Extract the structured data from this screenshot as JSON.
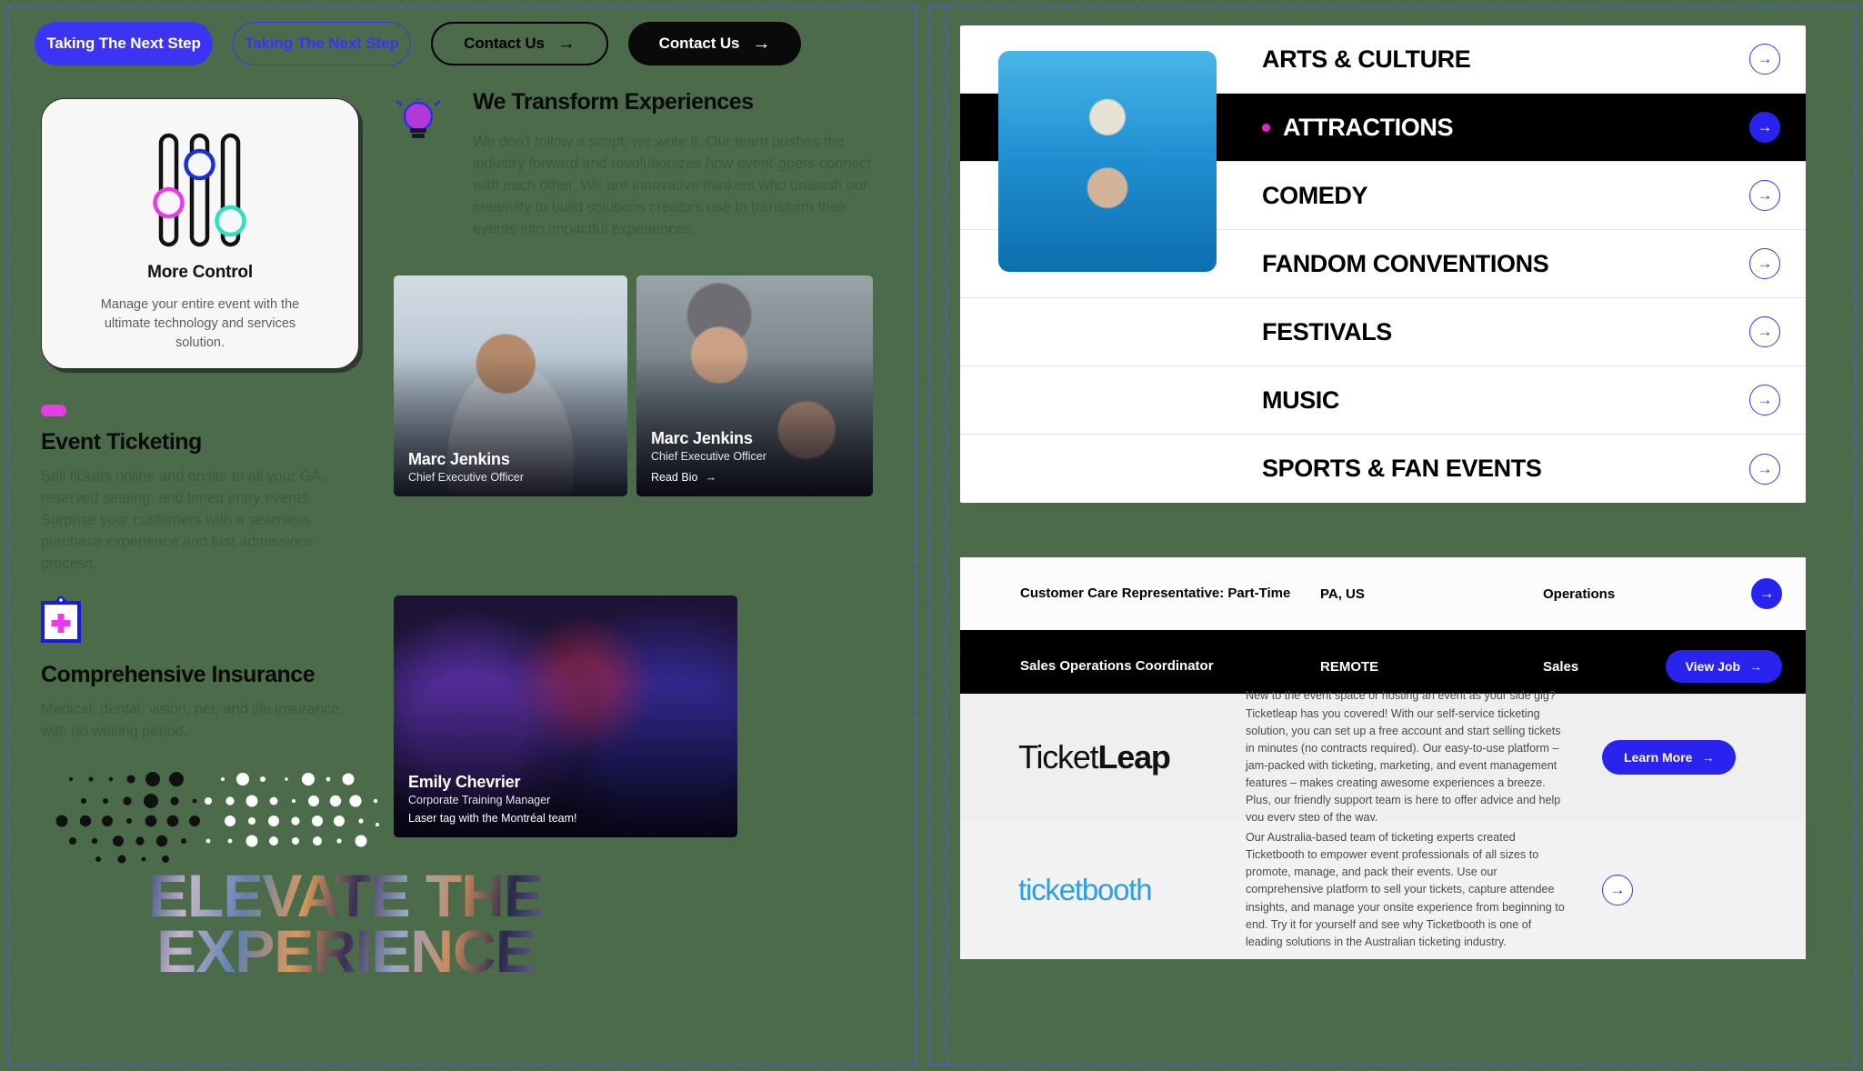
{
  "buttons": {
    "primary_label": "Taking The Next Step",
    "outline_label": "Taking The Next Step",
    "contact_outline_label": "Contact Us",
    "contact_dark_label": "Contact Us",
    "arrow_glyph": "→"
  },
  "control_card": {
    "title": "More Control",
    "description": "Manage your entire event with the ultimate technology and services solution.",
    "icon": "sliders-icon",
    "knob_colors": [
      "#e83ce8",
      "#1d2fd6",
      "#2fe0c0"
    ]
  },
  "features": [
    {
      "icon": "pill-badge-icon",
      "title": "Event Ticketing",
      "body": "Sell tickets online and onsite to all your GA, reserved seating, and timed entry events. Surprise your customers with a seamless purchase experience and fast admissions process."
    },
    {
      "icon": "clipboard-medical-icon",
      "title": "Comprehensive Insurance",
      "body": "Medical, dental, vision, pet, and life insurance with no waiting period."
    }
  ],
  "elevate": {
    "line1": "Elevate The",
    "line2": "Experience"
  },
  "transform": {
    "icon": "lightbulb-icon",
    "heading": "We Transform Experiences",
    "body": "We don't follow a script; we write it. Our team pushes the industry forward and revolutionizes how event-goers connect with each other. We are innovative thinkers who unleash our creativity to build solutions creators use to transform their events into impactful experiences."
  },
  "people": [
    {
      "name": "Marc Jenkins",
      "role": "Chief Executive Officer",
      "link": ""
    },
    {
      "name": "Marc Jenkins",
      "role": "Chief Executive Officer",
      "link": "Read Bio"
    },
    {
      "name": "Emily Chevrier",
      "role": "Corporate Training Manager",
      "link": "Laser tag with the Montréal team!"
    }
  ],
  "categories": {
    "items": [
      {
        "label": "ARTS & CULTURE",
        "active": false
      },
      {
        "label": "ATTRACTIONS",
        "active": true
      },
      {
        "label": "COMEDY",
        "active": false
      },
      {
        "label": "FANDOM CONVENTIONS",
        "active": false
      },
      {
        "label": "FESTIVALS",
        "active": false
      },
      {
        "label": "MUSIC",
        "active": false
      },
      {
        "label": "SPORTS & FAN EVENTS",
        "active": false
      }
    ],
    "arrow_glyph": "→"
  },
  "jobs": {
    "rows": [
      {
        "title": "Customer Care Representative: Part-Time",
        "location": "PA, US",
        "department": "Operations",
        "action": "",
        "dark": false
      },
      {
        "title": "Sales Operations Coordinator",
        "location": "REMOTE",
        "department": "Sales",
        "action": "View Job",
        "dark": true
      }
    ],
    "arrow_glyph": "→"
  },
  "brands": [
    {
      "logo_part1": "Ticket",
      "logo_part2": "Leap",
      "description": "New to the event space or hosting an event as your side gig? Ticketleap has you covered! With our self-service ticketing solution, you can set up a free account and start selling tickets in minutes (no contracts required). Our easy-to-use platform – jam-packed with ticketing, marketing, and event management features – makes creating awesome experiences a breeze. Plus, our friendly support team is here to offer advice and help you every step of the way.",
      "cta": "Learn More"
    },
    {
      "logo_part1": "ticketbooth",
      "logo_part2": "",
      "description": "Our Australia-based team of ticketing experts created Ticketbooth to empower event professionals of all sizes to promote, manage, and pack their events. Use our comprehensive platform to sell your tickets, capture attendee insights, and manage your onsite experience from beginning to end. Try it for yourself and see why Ticketbooth is one of leading solutions in the Australian ticketing industry.",
      "cta": ""
    }
  ],
  "colors": {
    "background": "#4b6b4b",
    "accent_blue": "#2a23f0",
    "accent_magenta": "#e226c8",
    "accent_teal": "#2fe0c0"
  }
}
